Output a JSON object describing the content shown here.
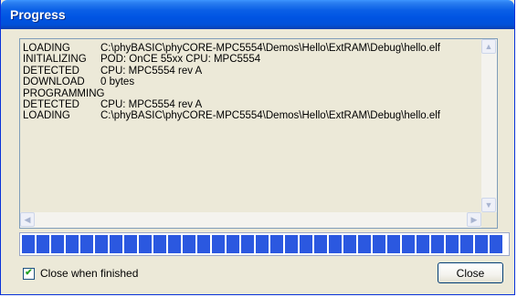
{
  "window": {
    "title": "Progress"
  },
  "log": [
    {
      "label": "LOADING",
      "value": "C:\\phyBASIC\\phyCORE-MPC5554\\Demos\\Hello\\ExtRAM\\Debug\\hello.elf"
    },
    {
      "label": "INITIALIZING",
      "value": "POD: OnCE 55xx  CPU: MPC5554"
    },
    {
      "label": "DETECTED",
      "value": "CPU: MPC5554 rev A"
    },
    {
      "label": "DOWNLOAD",
      "value": "0 bytes"
    },
    {
      "label": "PROGRAMMING",
      "value": ""
    },
    {
      "label": "DETECTED",
      "value": "CPU: MPC5554 rev A"
    },
    {
      "label": "LOADING",
      "value": "C:\\phyBASIC\\phyCORE-MPC5554\\Demos\\Hello\\ExtRAM\\Debug\\hello.elf"
    }
  ],
  "progress": {
    "fraction": 1.0,
    "color": "#2b58e0"
  },
  "options": {
    "close_when_finished_label": "Close when finished",
    "close_when_finished_checked": true
  },
  "buttons": {
    "close_label": "Close"
  },
  "icons": {
    "scroll_up": "▲",
    "scroll_down": "▼",
    "scroll_left": "◀",
    "scroll_right": "▶",
    "check": "✔"
  }
}
